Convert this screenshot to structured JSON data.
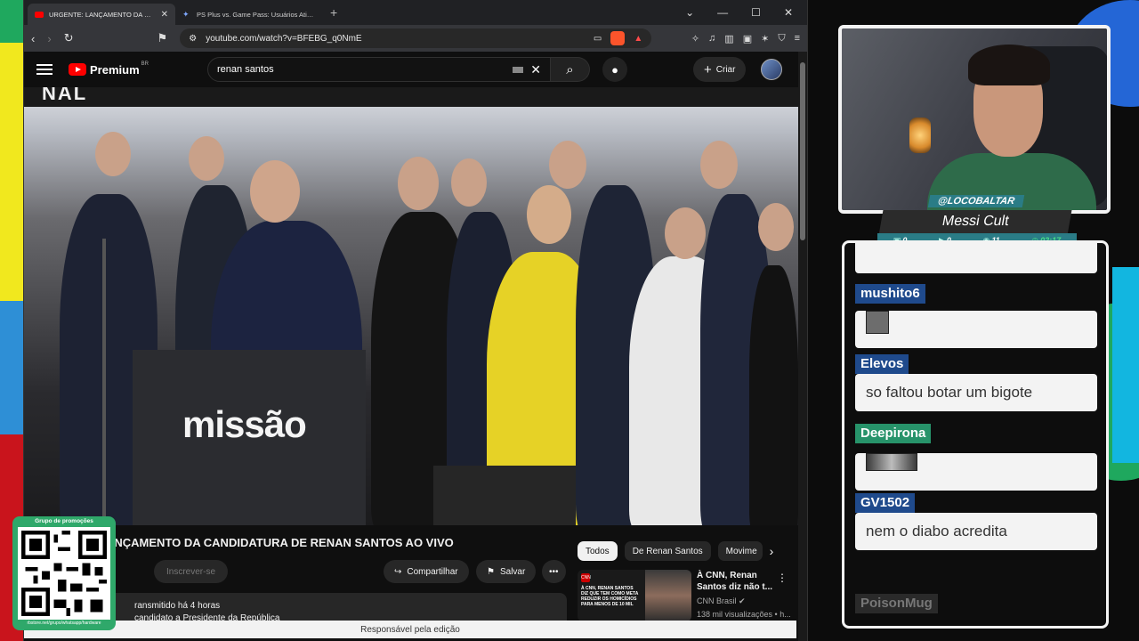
{
  "browser": {
    "tabs": [
      {
        "title": "URGENTE: LANÇAMENTO DA CANDIDATURA DE RENAN SANTOS",
        "active": true
      },
      {
        "title": "PS Plus vs. Game Pass: Usuários Ativos - Goo",
        "active": false
      }
    ],
    "new_tab": "+",
    "url": "youtube.com/watch?v=BFEBG_q0NmE"
  },
  "youtube": {
    "logo": "Premium",
    "region": "BR",
    "search_value": "renan santos",
    "create_label": "Criar",
    "video_title": "ANÇAMENTO DA CANDIDATURA DE RENAN SANTOS AO VIVO",
    "subscribe_label": "Inscrever-se",
    "share_label": "Compartilhar",
    "save_label": "Salvar",
    "desc_line1": "ransmitido há 4 horas",
    "desc_line2": "candidato a Presidente da República",
    "chips": [
      "Todos",
      "De Renan Santos",
      "Movime"
    ],
    "reco": {
      "title": "À CNN, Renan Santos diz não t...",
      "channel": "CNN Brasil",
      "views": "138 mil visualizações • h...",
      "thumb_text": "À CNN, RENAN SANTOS DIZ QUE TEM COMO META REDUZIR OS HOMICÍDIOS PARA MENOS DE 10 MIL",
      "thumb_badge": "CNN"
    },
    "status_bar": "Responsável pela edição"
  },
  "video_scene": {
    "banner": "NAL",
    "podium_text": "missão"
  },
  "promo": {
    "label": "Grupo de promoções",
    "url": "rbstore.net/grupo/whatsapp/hardware"
  },
  "stream": {
    "handle": "@LOCOBALTAR",
    "game": "Messi Cult",
    "stats": {
      "chat": "0",
      "subs": "0",
      "viewers": "11",
      "time": "02:17"
    }
  },
  "chat": {
    "messages": [
      {
        "user": "mushito6",
        "text": "",
        "type": "emote",
        "color": "#1f4a8c"
      },
      {
        "user": "Elevos",
        "text": "",
        "type": "text",
        "color": "#1f4a8c"
      },
      {
        "user": "Deepirona",
        "text": "",
        "type": "emote",
        "color": "#27936a"
      },
      {
        "user": "GV1502",
        "text": "",
        "type": "text",
        "color": "#1f4a8c"
      },
      {
        "user": "PoisonMug",
        "text": "",
        "type": "faded",
        "color": "#2a2a2a"
      }
    ],
    "texts": {
      "elevos": "so faltou botar um bigote",
      "gv1502": "nem o diabo acredita"
    }
  }
}
